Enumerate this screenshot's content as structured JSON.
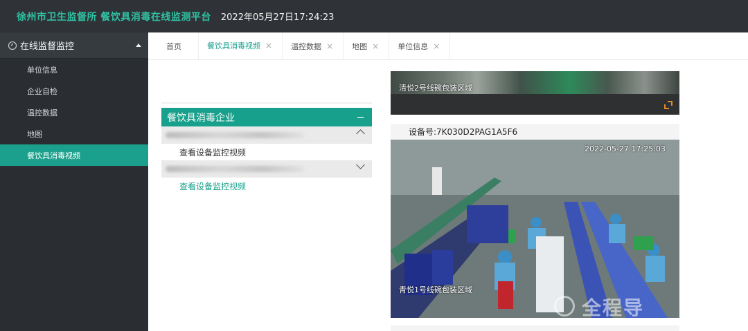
{
  "header": {
    "brand": "徐州市卫生监督所 餐饮具消毒在线监测平台",
    "datetime": "2022年05月27日17:24:23"
  },
  "sidebar": {
    "group_label": "在线监督监控",
    "items": [
      {
        "label": "单位信息",
        "active": false
      },
      {
        "label": "企业自检",
        "active": false
      },
      {
        "label": "温控数据",
        "active": false
      },
      {
        "label": "地图",
        "active": false
      },
      {
        "label": "餐饮具消毒视频",
        "active": true
      }
    ]
  },
  "tabs": [
    {
      "label": "首页",
      "closable": false,
      "active": false
    },
    {
      "label": "餐饮具消毒视频",
      "closable": true,
      "active": true
    },
    {
      "label": "温控数据",
      "closable": true,
      "active": false
    },
    {
      "label": "地图",
      "closable": true,
      "active": false
    },
    {
      "label": "单位信息",
      "closable": true,
      "active": false
    }
  ],
  "close_glyph": "×",
  "panel": {
    "title": "餐饮具消毒企业",
    "collapse_glyph": "−",
    "entries": [
      {
        "link_label": "查看设备监控视频",
        "expanded": true
      },
      {
        "link_label": "查看设备监控视频",
        "expanded": false
      }
    ]
  },
  "videos": [
    {
      "overlay_text": "清悦2号线碗包装区域"
    },
    {
      "device_label": "设备号:7K030D2PAG1A5F6",
      "timestamp": "2022-05-27 17:25:03",
      "overlay_text": "青悦1号线碗包装区域"
    }
  ],
  "watermark": "全程导"
}
